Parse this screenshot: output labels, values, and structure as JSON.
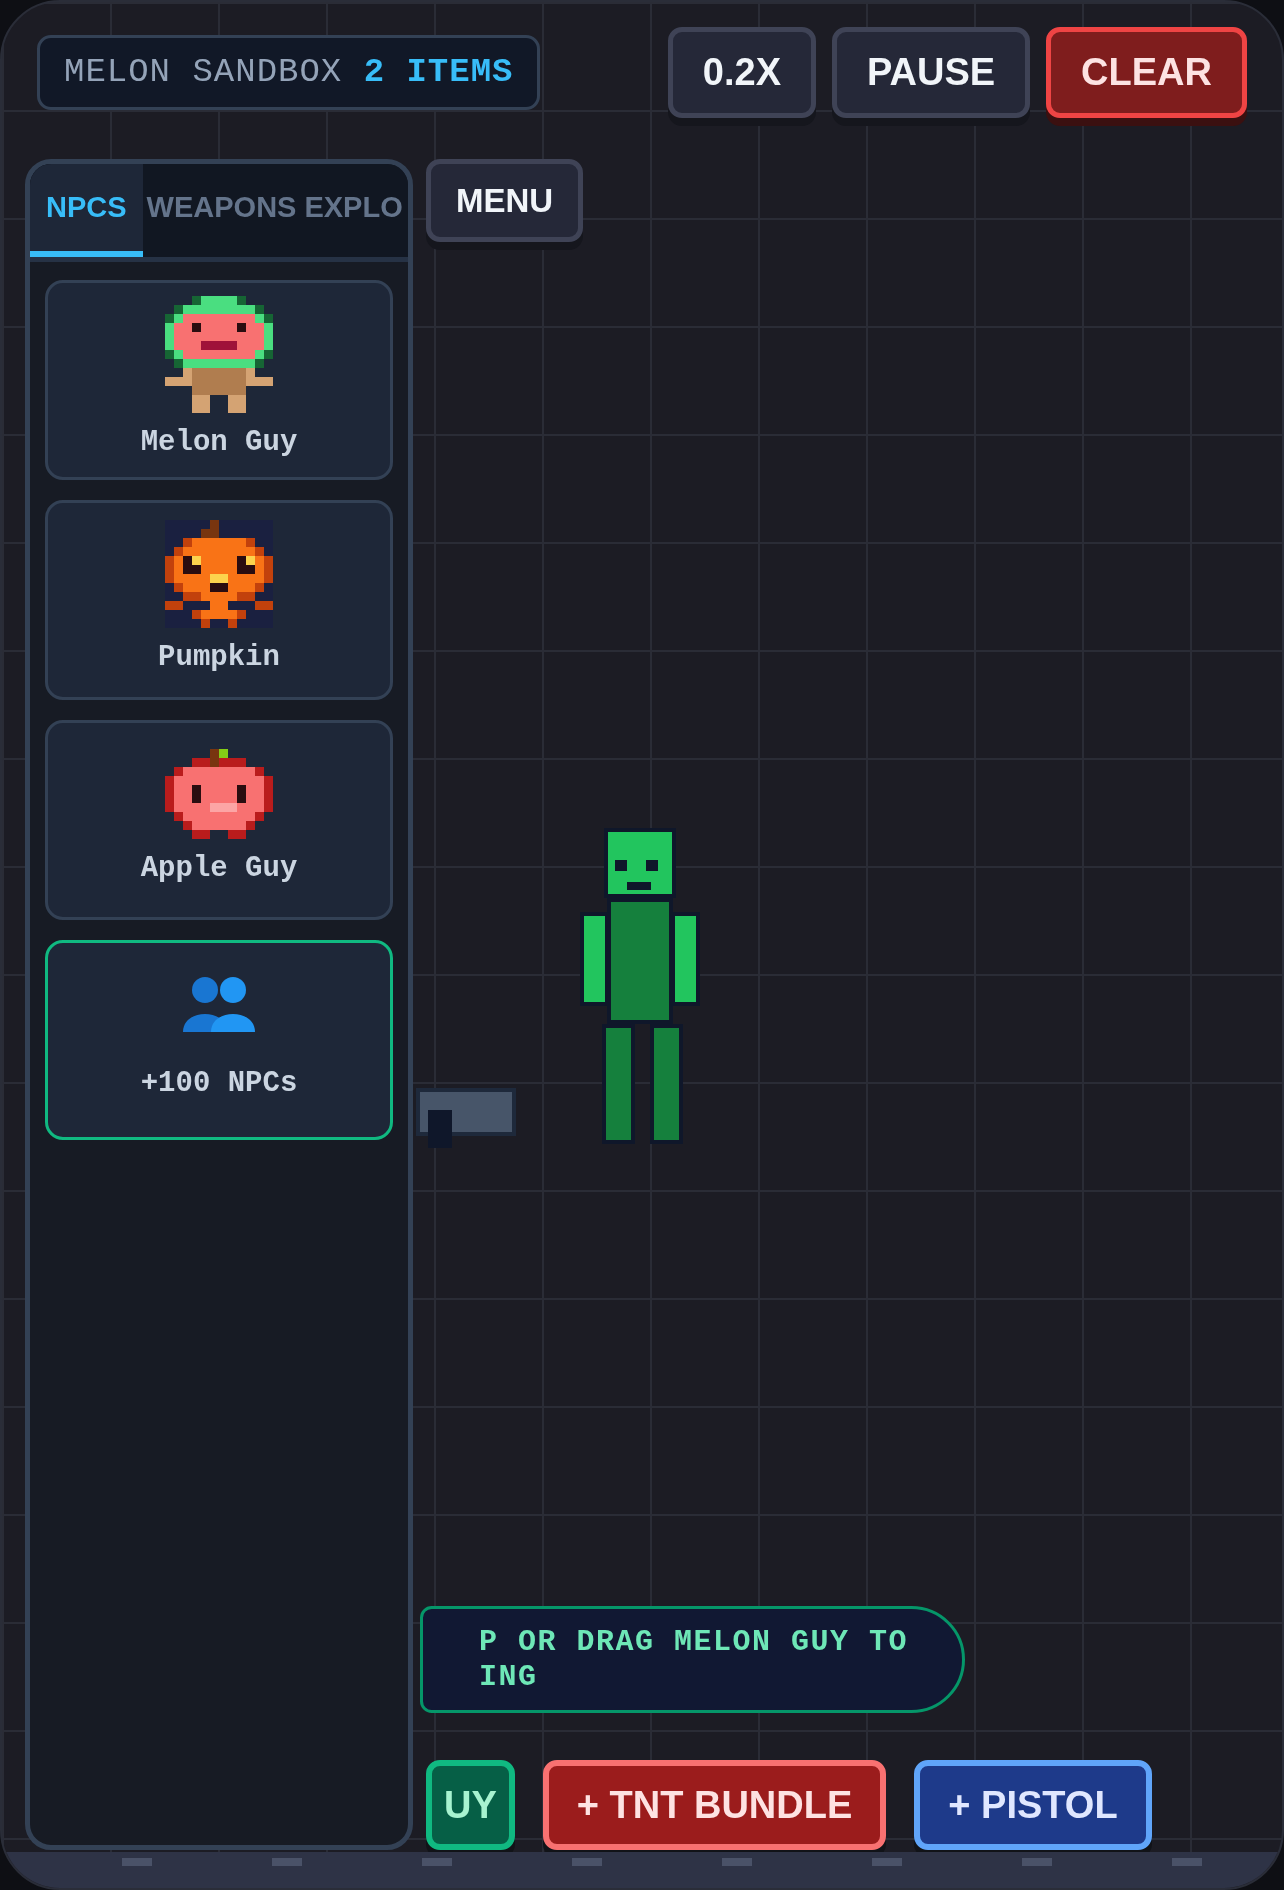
{
  "header": {
    "title": "MELON SANDBOX",
    "count": "2 ITEMS"
  },
  "controls": [
    {
      "label": "0.2X",
      "kind": "plain"
    },
    {
      "label": "PAUSE",
      "kind": "plain"
    },
    {
      "label": "CLEAR",
      "kind": "danger"
    }
  ],
  "sidebar": {
    "tabs": [
      {
        "label": "NPCS",
        "selected": true
      },
      {
        "label": "WEAPONS",
        "selected": false
      },
      {
        "label": "EXPLO",
        "selected": false
      }
    ],
    "items": [
      {
        "label": "Melon Guy",
        "kind": "melon",
        "selected": false
      },
      {
        "label": "Pumpkin",
        "kind": "pumpkin",
        "selected": false
      },
      {
        "label": "Apple Guy",
        "kind": "apple",
        "selected": false
      },
      {
        "label": "+100 NPCs",
        "kind": "group",
        "selected": true
      }
    ]
  },
  "menu_button": "MENU",
  "canvas_objects": [
    {
      "kind": "figure"
    },
    {
      "kind": "pistol"
    }
  ],
  "hint": {
    "lines": [
      "P OR DRAG MELON GUY TO",
      "ING"
    ]
  },
  "spawn_buttons": [
    {
      "label": "UY",
      "kind": "green"
    },
    {
      "label": "+ TNT BUNDLE",
      "kind": "red"
    },
    {
      "label": "+ PISTOL",
      "kind": "blue"
    }
  ]
}
